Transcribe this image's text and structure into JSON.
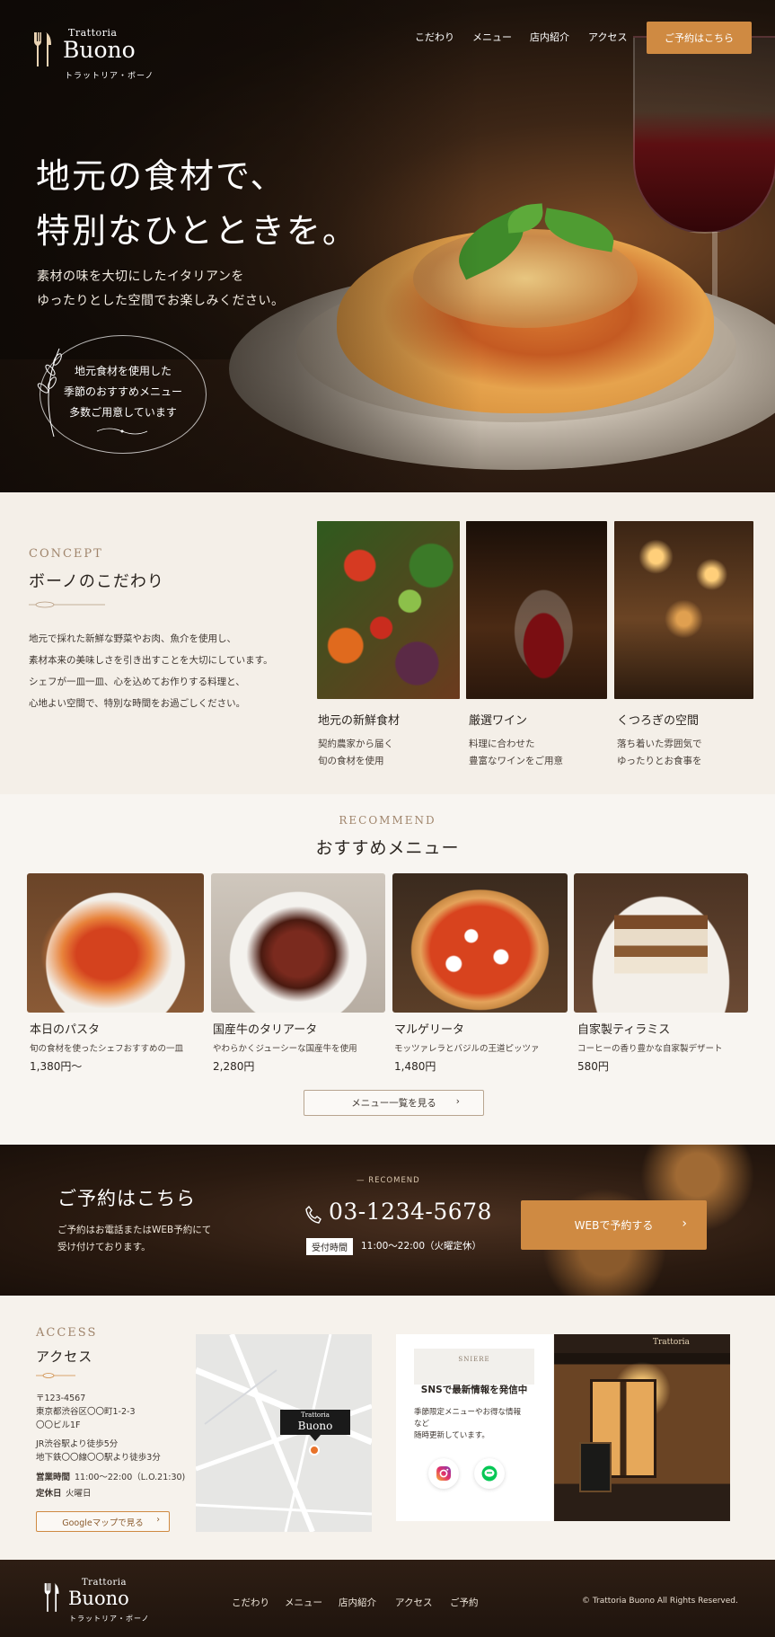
{
  "brand": {
    "small": "Trattoria",
    "name": "Buono",
    "kana": "トラットリア・ボーノ"
  },
  "nav": {
    "items": [
      "こだわり",
      "メニュー",
      "店内紹介",
      "アクセス"
    ],
    "reserve_label": "ご予約はこちら"
  },
  "hero": {
    "title_line1": "地元の食材で、",
    "title_line2": "特別なひとときを。",
    "sub_line1": "素材の味を大切にしたイタリアンを",
    "sub_line2": "ゆったりとした空間でお楽しみください。",
    "badge_line1": "地元食材を使用した",
    "badge_line2": "季節のおすすめメニュー",
    "badge_line3": "多数ご用意しています"
  },
  "concept": {
    "eyebrow": "CONCEPT",
    "title": "ボーノのこだわり",
    "body": [
      "地元で採れた新鮮な野菜やお肉、魚介を使用し、",
      "素材本来の美味しさを引き出すことを大切にしています。",
      "シェフが一皿一皿、心を込めてお作りする料理と、",
      "心地よい空間で、特別な時間をお過ごしください。"
    ],
    "cards": [
      {
        "title": "地元の新鮮食材",
        "line1": "契約農家から届く",
        "line2": "旬の食材を使用"
      },
      {
        "title": "厳選ワイン",
        "line1": "料理に合わせた",
        "line2": "豊富なワインをご用意"
      },
      {
        "title": "くつろぎの空間",
        "line1": "落ち着いた雰囲気で",
        "line2": "ゆったりとお食事を"
      }
    ]
  },
  "recommend": {
    "eyebrow": "RECOMMEND",
    "title": "おすすめメニュー",
    "items": [
      {
        "name": "本日のパスタ",
        "desc": "旬の食材を使ったシェフおすすめの一皿",
        "price": "1,380円〜"
      },
      {
        "name": "国産牛のタリアータ",
        "desc": "やわらかくジューシーな国産牛を使用",
        "price": "2,280円"
      },
      {
        "name": "マルゲリータ",
        "desc": "モッツァレラとバジルの王道ピッツァ",
        "price": "1,480円"
      },
      {
        "name": "自家製ティラミス",
        "desc": "コーヒーの香り豊かな自家製デザート",
        "price": "580円"
      }
    ],
    "button_label": "メニュー一覧を見る"
  },
  "reservation": {
    "title": "ご予約はこちら",
    "line1": "ご予約はお電話またはWEB予約にて",
    "line2": "受け付けております。",
    "eyebrow": "— RECOMEND",
    "phone": "03-1234-5678",
    "hours_badge": "受付時間",
    "hours": "11:00〜22:00（火曜定休）",
    "web_button": "WEBで予約する"
  },
  "access": {
    "eyebrow": "ACCESS",
    "title": "アクセス",
    "address": [
      "〒123-4567",
      "東京都渋谷区〇〇町1-2-3",
      "〇〇ビル1F"
    ],
    "transit": [
      "JR渋谷駅より徒歩5分",
      "地下鉄〇〇線〇〇駅より徒歩3分"
    ],
    "hours_label": "営業時間",
    "hours_value": "11:00〜22:00（L.O.21:30)",
    "closed_label": "定休日",
    "closed_value": "火曜日",
    "map_button": "Googleマップで見る",
    "map_pin_small": "Trattoria",
    "map_pin_name": "Buono",
    "sns_tag": "SNIERE",
    "sns_title": "SNSで最新情報を発信中",
    "sns_body": [
      "季節限定メニューやお得な情報",
      "など",
      "随時更新しています。"
    ],
    "shop_sign": "Trattoria"
  },
  "footer": {
    "nav": [
      "こだわり",
      "メニュー",
      "店内紹介",
      "アクセス",
      "ご予約"
    ],
    "copyright": "© Trattoria Buono All Rights Reserved."
  },
  "colors": {
    "accent": "#cf8a42",
    "dark": "#2b2520",
    "cream": "#f6f2ec"
  }
}
